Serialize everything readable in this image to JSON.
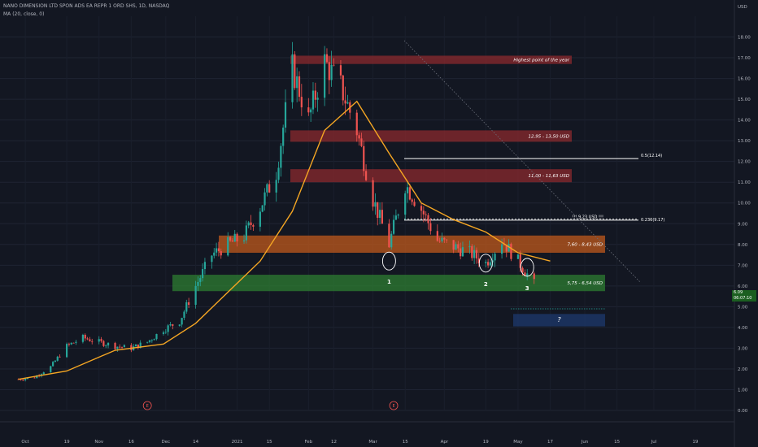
{
  "header": {
    "symbol_line": "NANO DIMENSION LTD SPON ADS EA REPR 1 ORD SHS, 1D, NASDAQ",
    "indicator_line": "MA (20, close, 0)",
    "currency": "USD"
  },
  "price_tag": {
    "price": "6.09",
    "countdown": "06:07:10"
  },
  "chart_data": {
    "type": "candlestick",
    "title": "NANO DIMENSION LTD SPON ADS EA REPR 1 ORD SHS, 1D, NASDAQ",
    "ylim": [
      0,
      19
    ],
    "y_ticks": [
      "0.00",
      "1.00",
      "2.00",
      "3.00",
      "4.00",
      "5.00",
      "6.00",
      "7.00",
      "8.00",
      "9.00",
      "10.00",
      "11.00",
      "12.00",
      "13.00",
      "14.00",
      "15.00",
      "16.00",
      "17.00",
      "18.00"
    ],
    "x_ticks": [
      "Oct",
      "19",
      "Nov",
      "16",
      "Dec",
      "14",
      "2021",
      "15",
      "Feb",
      "12",
      "Mar",
      "15",
      "Apr",
      "19",
      "May",
      "17",
      "Jun",
      "15",
      "Jul",
      "19"
    ],
    "grid": true,
    "colors": {
      "up": "#26a69a",
      "down": "#ef5350",
      "ma": "#f5a623",
      "background": "#131722"
    },
    "close_path": [
      [
        "2020-09-28",
        1.5
      ],
      [
        "2020-10-05",
        1.6
      ],
      [
        "2020-10-12",
        2.1
      ],
      [
        "2020-10-19",
        3.1
      ],
      [
        "2020-10-26",
        3.5
      ],
      [
        "2020-11-02",
        3.3
      ],
      [
        "2020-11-09",
        3.1
      ],
      [
        "2020-11-16",
        3.0
      ],
      [
        "2020-11-23",
        3.3
      ],
      [
        "2020-11-30",
        3.9
      ],
      [
        "2020-12-07",
        4.3
      ],
      [
        "2020-12-14",
        6.0
      ],
      [
        "2020-12-21",
        7.5
      ],
      [
        "2020-12-28",
        8.0
      ],
      [
        "2021-01-04",
        8.4
      ],
      [
        "2021-01-11",
        9.8
      ],
      [
        "2021-01-18",
        11.5
      ],
      [
        "2021-01-25",
        16.5
      ],
      [
        "2021-02-01",
        14.0
      ],
      [
        "2021-02-08",
        16.8
      ],
      [
        "2021-02-15",
        15.6
      ],
      [
        "2021-02-22",
        13.5
      ],
      [
        "2021-03-01",
        10.2
      ],
      [
        "2021-03-08",
        8.0
      ],
      [
        "2021-03-15",
        10.9
      ],
      [
        "2021-03-22",
        9.7
      ],
      [
        "2021-03-29",
        8.2
      ],
      [
        "2021-04-05",
        7.9
      ],
      [
        "2021-04-12",
        7.6
      ],
      [
        "2021-04-19",
        7.1
      ],
      [
        "2021-04-26",
        8.2
      ],
      [
        "2021-05-03",
        7.2
      ],
      [
        "2021-05-10",
        6.09
      ]
    ],
    "ma_path": [
      [
        "2020-09-28",
        1.5
      ],
      [
        "2020-10-19",
        1.9
      ],
      [
        "2020-11-09",
        2.9
      ],
      [
        "2020-11-30",
        3.2
      ],
      [
        "2020-12-14",
        4.2
      ],
      [
        "2020-12-28",
        5.7
      ],
      [
        "2021-01-11",
        7.2
      ],
      [
        "2021-01-25",
        9.6
      ],
      [
        "2021-02-08",
        13.5
      ],
      [
        "2021-02-22",
        14.9
      ],
      [
        "2021-03-08",
        12.4
      ],
      [
        "2021-03-22",
        10.0
      ],
      [
        "2021-04-05",
        9.2
      ],
      [
        "2021-04-19",
        8.6
      ],
      [
        "2021-05-03",
        7.6
      ],
      [
        "2021-05-17",
        7.2
      ]
    ],
    "zones": [
      {
        "label": "Highest point of the year",
        "low": 16.7,
        "high": 17.1,
        "color": "#8b2a2e"
      },
      {
        "label": "12,95 - 13,50 USD",
        "low": 12.95,
        "high": 13.5,
        "color": "#8b2a2e"
      },
      {
        "label": "11,00 - 11,63 USD",
        "low": 11.0,
        "high": 11.63,
        "color": "#8b2a2e"
      },
      {
        "label": "7,60 - 8,43 USD",
        "low": 7.6,
        "high": 8.43,
        "color": "#c05a1c"
      },
      {
        "label": "5,75 - 6,54 USD",
        "low": 5.75,
        "high": 6.54,
        "color": "#2e7d32"
      },
      {
        "label": "?",
        "low": 4.05,
        "high": 4.65,
        "color": "#1e3a6e"
      }
    ],
    "levels": [
      {
        "label": "0.5(12.14)",
        "value": 12.14
      },
      {
        "label": "0.236(9.17)",
        "value": 9.17
      },
      {
        "label": "!!! 9,23 USD !!!",
        "value": 9.23
      }
    ],
    "markers": [
      {
        "label": "1",
        "date": "2021-03-08",
        "value": 7.2
      },
      {
        "label": "2",
        "date": "2021-04-19",
        "value": 7.1
      },
      {
        "label": "3",
        "date": "2021-05-07",
        "value": 6.9
      }
    ],
    "earnings": [
      "2020-11-23",
      "2021-03-10"
    ],
    "earnings_label": "E"
  }
}
